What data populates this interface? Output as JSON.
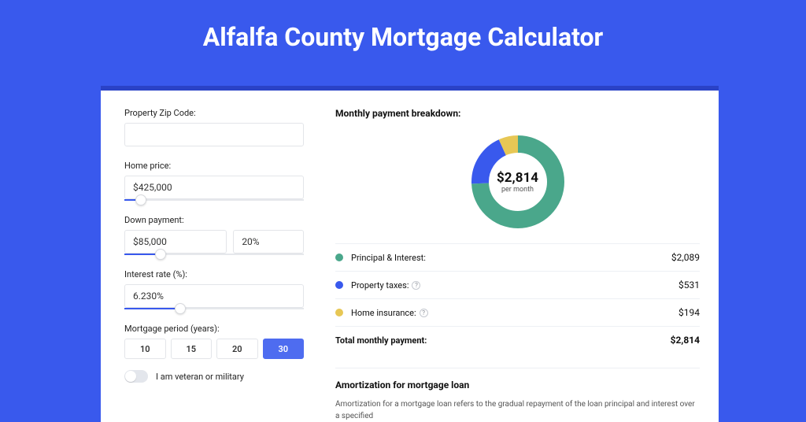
{
  "title": "Alfalfa County Mortgage Calculator",
  "colors": {
    "green": "#4aa78b",
    "blue": "#3959ed",
    "yellow": "#e7c755"
  },
  "form": {
    "zip": {
      "label": "Property Zip Code:",
      "value": ""
    },
    "home_price": {
      "label": "Home price:",
      "value": "$425,000",
      "slider_pct": 9
    },
    "down_payment": {
      "label": "Down payment:",
      "amount": "$85,000",
      "percent": "20%",
      "slider_pct": 20
    },
    "interest": {
      "label": "Interest rate (%):",
      "value": "6.230%",
      "slider_pct": 31
    },
    "period": {
      "label": "Mortgage period (years):",
      "options": [
        "10",
        "15",
        "20",
        "30"
      ],
      "selected": "30"
    },
    "veteran": {
      "label": "I am veteran or military",
      "on": false
    }
  },
  "breakdown": {
    "heading": "Monthly payment breakdown:",
    "center_amount": "$2,814",
    "center_sub": "per month",
    "items": [
      {
        "label": "Principal & Interest:",
        "value": "$2,089",
        "color": "green",
        "has_help": false
      },
      {
        "label": "Property taxes:",
        "value": "$531",
        "color": "blue",
        "has_help": true
      },
      {
        "label": "Home insurance:",
        "value": "$194",
        "color": "yellow",
        "has_help": true
      }
    ],
    "total_label": "Total monthly payment:",
    "total_value": "$2,814"
  },
  "chart_data": {
    "type": "pie",
    "title": "Monthly payment breakdown",
    "categories": [
      "Principal & Interest",
      "Property taxes",
      "Home insurance"
    ],
    "values": [
      2089,
      531,
      194
    ],
    "colors": [
      "#4aa78b",
      "#3959ed",
      "#e7c755"
    ],
    "total": 2814
  },
  "amortization": {
    "heading": "Amortization for mortgage loan",
    "desc": "Amortization for a mortgage loan refers to the gradual repayment of the loan principal and interest over a specified"
  }
}
